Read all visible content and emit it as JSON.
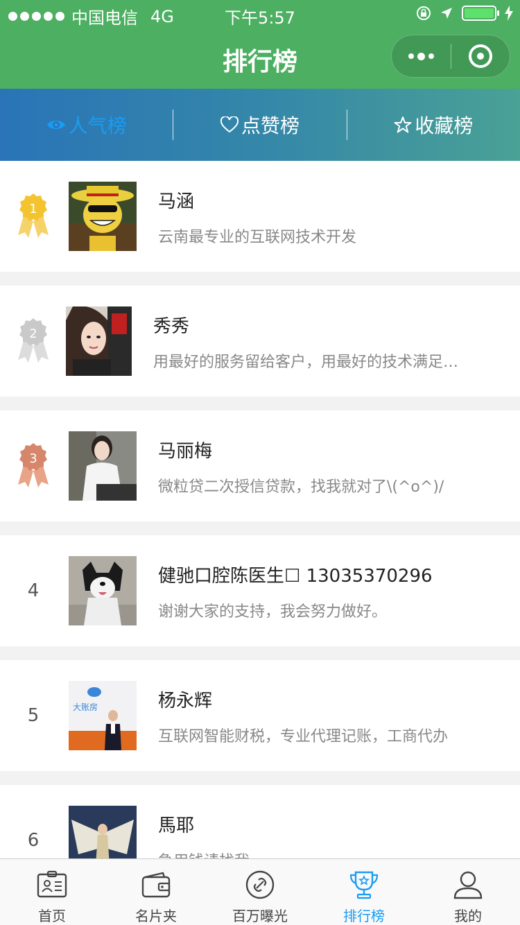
{
  "status": {
    "carrier": "中国电信",
    "network": "4G",
    "time": "下午5:57"
  },
  "navbar": {
    "title": "排行榜"
  },
  "tabs": [
    {
      "label": "人气榜",
      "icon": "eye-icon",
      "active": true
    },
    {
      "label": "点赞榜",
      "icon": "heart-icon",
      "active": false
    },
    {
      "label": "收藏榜",
      "icon": "star-icon",
      "active": false
    }
  ],
  "ranking": [
    {
      "rank": "1",
      "medal": "gold",
      "name": "马涵",
      "desc": "云南最专业的互联网技术开发"
    },
    {
      "rank": "2",
      "medal": "silver",
      "name": "秀秀",
      "desc": "用最好的服务留给客户，用最好的技术满足…"
    },
    {
      "rank": "3",
      "medal": "bronze",
      "name": "马丽梅",
      "desc": "微粒贷二次授信贷款，找我就对了\\(^o^)/"
    },
    {
      "rank": "4",
      "medal": "",
      "name": "健驰口腔陈医生☐ 13035370296",
      "desc": "谢谢大家的支持，我会努力做好。"
    },
    {
      "rank": "5",
      "medal": "",
      "name": "杨永辉",
      "desc": "互联网智能财税，专业代理记账，工商代办"
    },
    {
      "rank": "6",
      "medal": "",
      "name": "馬耶",
      "desc": "急用钱请找我"
    }
  ],
  "bottom_nav": [
    {
      "label": "首页",
      "icon": "id-card-icon",
      "active": false
    },
    {
      "label": "名片夹",
      "icon": "wallet-icon",
      "active": false
    },
    {
      "label": "百万曝光",
      "icon": "link-circle-icon",
      "active": false
    },
    {
      "label": "排行榜",
      "icon": "trophy-icon",
      "active": true
    },
    {
      "label": "我的",
      "icon": "user-icon",
      "active": false
    }
  ],
  "colors": {
    "brand_green": "#4caf61",
    "active_blue": "#1a9cf2",
    "gold": "#f4c430",
    "silver": "#c9c9c9",
    "bronze": "#d6866a"
  }
}
